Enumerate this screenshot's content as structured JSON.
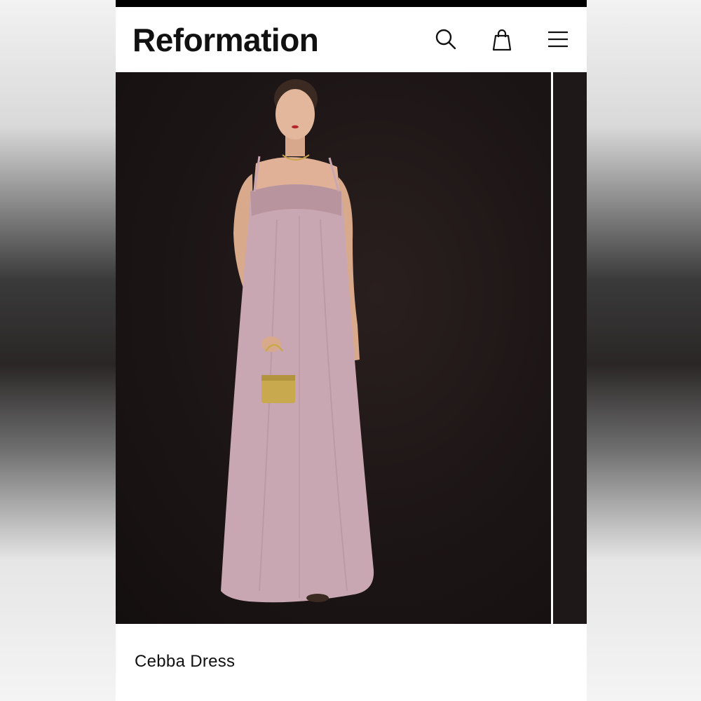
{
  "header": {
    "brand": "Reformation",
    "icons": [
      "search-icon",
      "shopping-bag-icon",
      "menu-icon"
    ]
  },
  "product": {
    "name": "Cebba Dress",
    "image": "model-in-pink-maxi-dress-photo"
  },
  "colors": {
    "brand_text": "#111111",
    "photo_background": "#1a1414",
    "dress": "#c9a7b2",
    "bag": "#c8a94e"
  }
}
